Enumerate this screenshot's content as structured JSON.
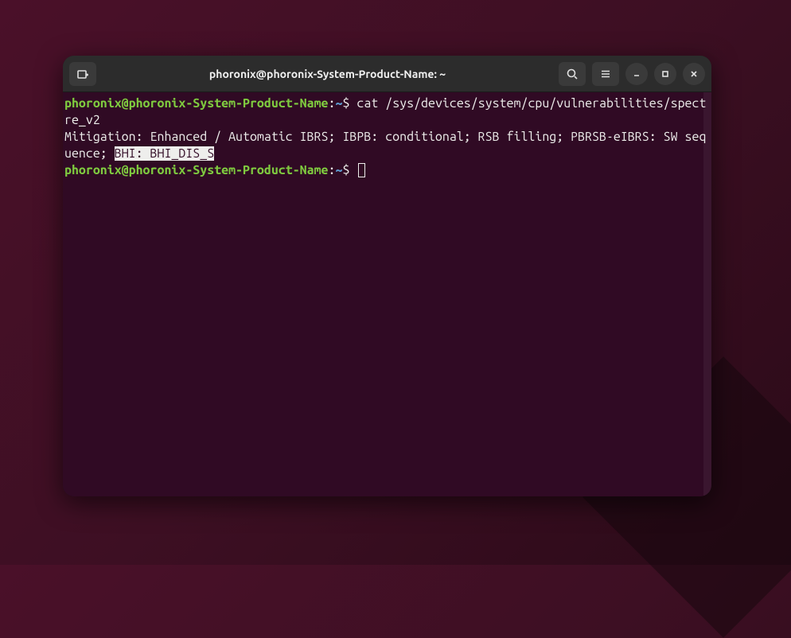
{
  "window": {
    "title": "phoronix@phoronix-System-Product-Name: ~"
  },
  "icons": {
    "new_tab": "new-tab-icon",
    "search": "search-icon",
    "menu": "hamburger-icon",
    "minimize": "minimize-icon",
    "maximize": "maximize-icon",
    "close": "close-icon"
  },
  "prompt": {
    "user_host": "phoronix@phoronix-System-Product-Name",
    "separator": ":",
    "path": "~",
    "symbol": "$"
  },
  "lines": {
    "cmd1": " cat /sys/devices/system/cpu/vulnerabilities/spectre_v2",
    "output_prefix": "Mitigation: Enhanced / Automatic IBRS; IBPB: conditional; RSB filling; PBRSB-eIBRS: SW sequence; ",
    "output_highlight": "BHI: BHI_DIS_S",
    "cmd2": " "
  }
}
